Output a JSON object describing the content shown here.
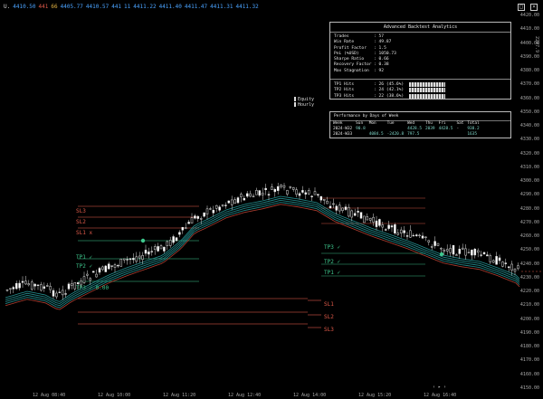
{
  "header": {
    "ohlc": [
      "U.",
      "4410.50",
      "441",
      "66",
      "4405.77",
      "4410.57",
      "441",
      "11",
      "4411.22",
      "4411.40",
      "4411.47",
      "4411.31",
      "4411.32"
    ]
  },
  "stats_panel": {
    "title": "Advanced Backtest Analytics",
    "rows": [
      {
        "k": "Trades",
        "v": ": 57"
      },
      {
        "k": "Win Rate",
        "v": ": 49.87"
      },
      {
        "k": "Profit Factor",
        "v": ": 1.5"
      },
      {
        "k": "PnL (%USD)",
        "v": ": 1050.73"
      },
      {
        "k": "Sharpe Ratio",
        "v": ": 0.66"
      },
      {
        "k": "Recovery Factor",
        "v": ": 0.38"
      },
      {
        "k": "Max Stagnation",
        "v": ": 92"
      }
    ],
    "tp_rows": [
      {
        "k": "TP1 Hits",
        "v": ": 26 (45.6%)"
      },
      {
        "k": "TP2 Hits",
        "v": ": 24 (42.1%)"
      },
      {
        "k": "TP3 Hits",
        "v": ": 22 (38.6%)"
      }
    ]
  },
  "legend": {
    "items": [
      "Equity",
      "Hourly"
    ]
  },
  "performance": {
    "title": "Performance by Days of Week",
    "header": [
      "Week",
      "Sun",
      "Mon",
      "Tue",
      "Wed",
      "Thu",
      "Fri",
      "Sat",
      "Total"
    ],
    "rows": [
      [
        "2024-W32",
        "90.8",
        "",
        "",
        "4428.5",
        "2039",
        "4428.5",
        "-",
        "938.2"
      ],
      [
        "2024-W33",
        "",
        "4084.5",
        "-2420.8",
        "797.5",
        "",
        "",
        "",
        "1635"
      ]
    ]
  },
  "levels": {
    "left": [
      {
        "label": "SL3",
        "kind": "sl"
      },
      {
        "label": "SL2",
        "kind": "sl"
      },
      {
        "label": "SL1 x",
        "kind": "sl"
      },
      {
        "label": "TP1 ✓",
        "kind": "tp"
      },
      {
        "label": "TP2 ✓",
        "kind": "tp"
      },
      {
        "label": "TP3 ✓ 0.00",
        "kind": "tp"
      }
    ],
    "right": [
      {
        "label": "TP3 ✓",
        "kind": "tp"
      },
      {
        "label": "TP2 ✓",
        "kind": "tp"
      },
      {
        "label": "TP1 ✓",
        "kind": "tp"
      },
      {
        "label": "SL1",
        "kind": "sl"
      },
      {
        "label": "SL2",
        "kind": "sl"
      },
      {
        "label": "SL3",
        "kind": "sl"
      }
    ]
  },
  "y_axis": {
    "labels": [
      "4420.00",
      "4410.00",
      "4400.00",
      "4390.00",
      "4380.00",
      "4370.00",
      "4360.00",
      "4350.00",
      "4340.00",
      "4330.00",
      "4320.00",
      "4310.00",
      "4300.00",
      "4290.00",
      "4280.00",
      "4270.00",
      "4260.00",
      "4250.00",
      "4240.00",
      "4230.00",
      "4220.00",
      "4210.00",
      "4200.00",
      "4190.00",
      "4180.00",
      "4170.00",
      "4160.00",
      "4150.00"
    ]
  },
  "x_axis": {
    "labels": [
      "12 Aug 08:40",
      "12 Aug 10:00",
      "12 Aug 11:20",
      "12 Aug 12:40",
      "12 Aug 14:00",
      "12 Aug 15:20",
      "12 Aug 16:40"
    ]
  },
  "colors": {
    "up": "#e8e8e8",
    "down": "#e8e8e8",
    "ema_teal": "#2aa8a8",
    "ema_red": "#d04a3a",
    "sl": "#e05a4a",
    "tp": "#3ec98e"
  }
}
